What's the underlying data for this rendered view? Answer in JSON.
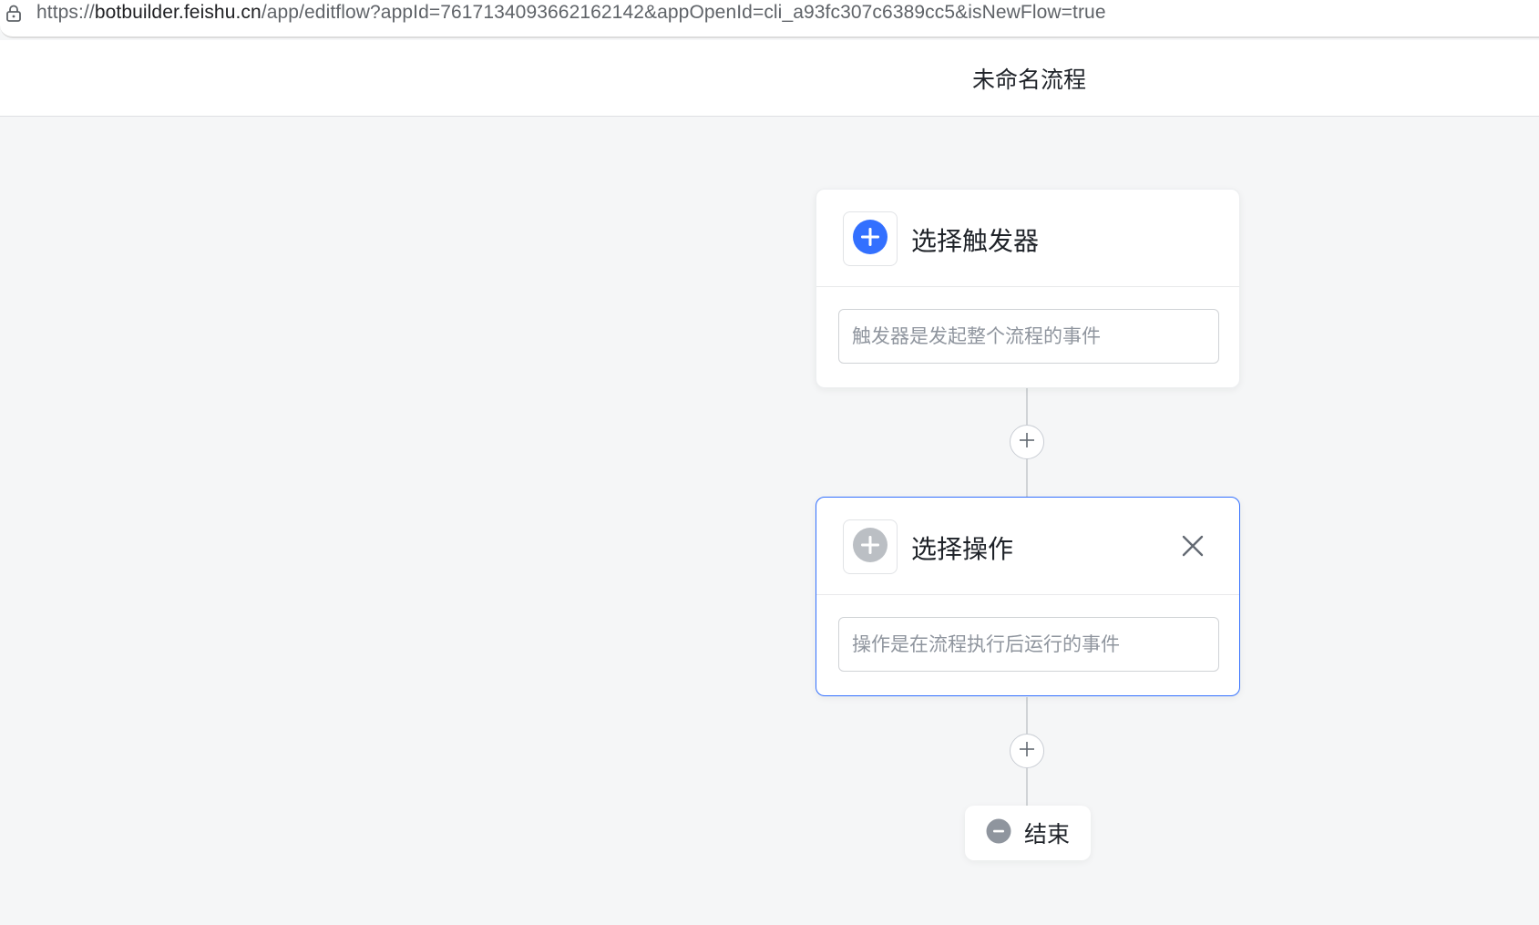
{
  "browser": {
    "url_host_prefix": "https://",
    "url_host": "botbuilder.feishu.cn",
    "url_path": "/app/editflow?appId=7617134093662162142&appOpenId=cli_a93fc307c6389cc5&isNewFlow=true"
  },
  "header": {
    "title": "未命名流程"
  },
  "nodes": {
    "trigger": {
      "title": "选择触发器",
      "description": "触发器是发起整个流程的事件",
      "icon": "plus-circle-icon",
      "icon_color": "#3370ff"
    },
    "action": {
      "title": "选择操作",
      "description": "操作是在流程执行后运行的事件",
      "icon": "plus-circle-icon",
      "icon_color": "#bbbfc4",
      "close_icon": "close-icon"
    },
    "end": {
      "label": "结束",
      "icon": "minus-circle-icon",
      "icon_color": "#8f959e"
    }
  },
  "colors": {
    "accent": "#3370ff",
    "canvas_bg": "#f5f6f7",
    "border": "#dee0e3"
  }
}
